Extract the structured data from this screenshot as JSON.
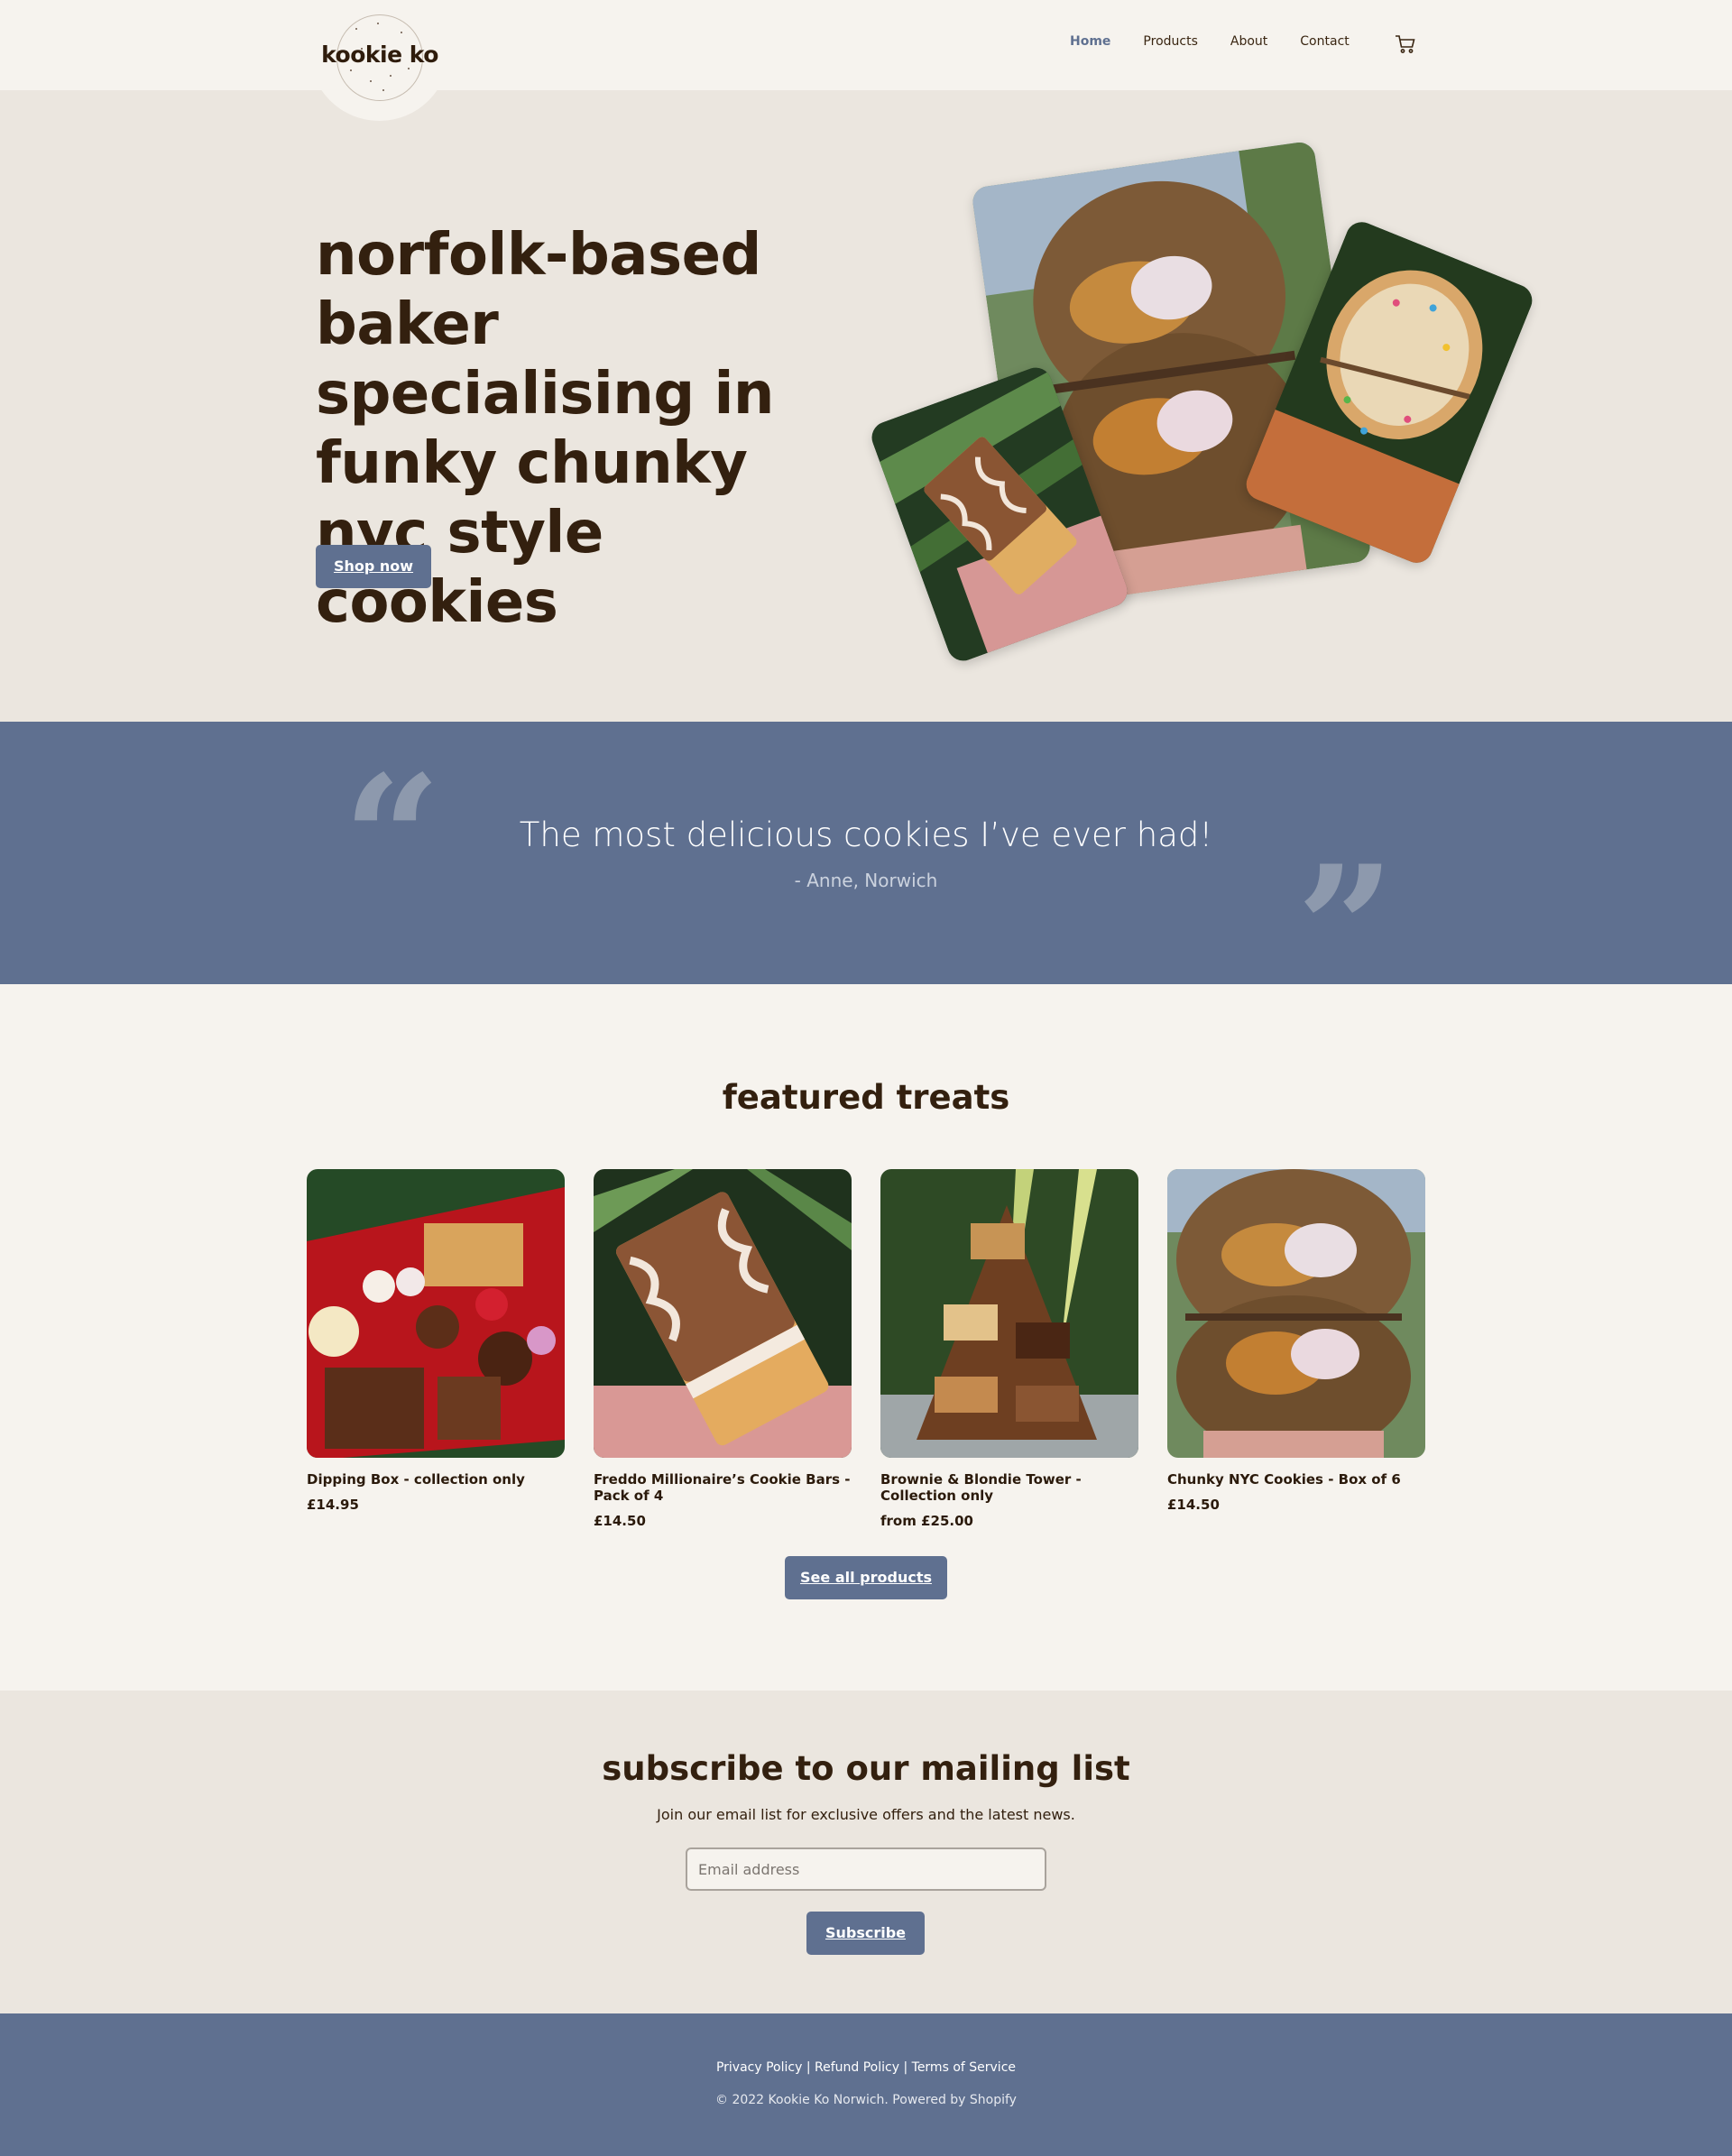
{
  "brand": {
    "name": "kookie ko"
  },
  "nav": {
    "items": [
      {
        "label": "Home",
        "active": true
      },
      {
        "label": "Products",
        "active": false
      },
      {
        "label": "About",
        "active": false
      },
      {
        "label": "Contact",
        "active": false
      }
    ],
    "cart_icon": "cart-icon"
  },
  "hero": {
    "title": "norfolk-based baker specialising in funky chunky nyc style cookies",
    "button": "Shop now"
  },
  "testimonial": {
    "quote": "The most delicious cookies I’ve ever had!",
    "author": "- Anne, Norwich"
  },
  "featured": {
    "title": "featured treats",
    "products": [
      {
        "name": "Dipping Box - collection only",
        "price": "£14.95"
      },
      {
        "name": "Freddo Millionaire’s Cookie Bars - Pack of 4",
        "price": "£14.50"
      },
      {
        "name": "Brownie & Blondie Tower - Collection only",
        "price": "from £25.00"
      },
      {
        "name": "Chunky NYC Cookies - Box of 6",
        "price": "£14.50"
      }
    ],
    "see_all": "See all products"
  },
  "subscribe": {
    "title": "subscribe to our mailing list",
    "description": "Join our email list for exclusive offers and the latest news.",
    "placeholder": "Email address",
    "button": "Subscribe"
  },
  "footer": {
    "links": [
      "Privacy Policy",
      "Refund Policy",
      "Terms of Service"
    ],
    "separator": "|",
    "copyright": "© 2022 Kookie Ko Norwich. Powered by Shopify"
  },
  "colors": {
    "accent": "#5f7090",
    "text_dark": "#33200f",
    "background": "#f6f3ee",
    "section_bg": "#ebe6df"
  }
}
